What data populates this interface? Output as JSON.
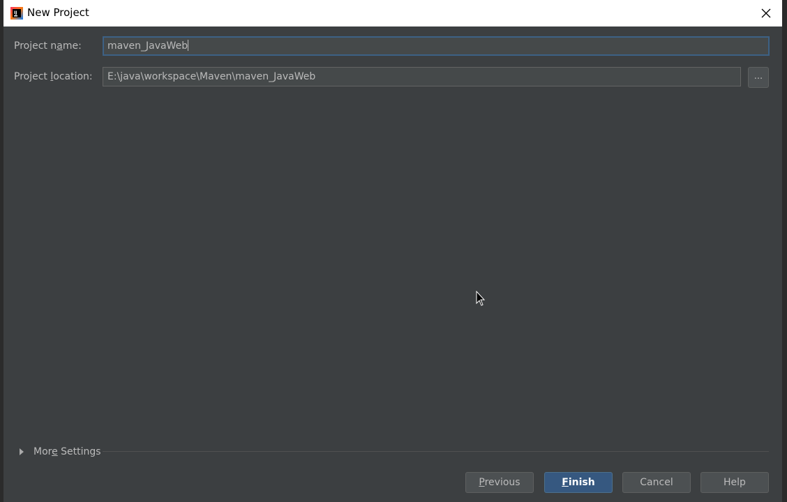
{
  "window": {
    "title": "New Project",
    "app_icon": "intellij-idea-icon",
    "close_icon": "close-icon"
  },
  "form": {
    "project_name": {
      "label_pre": "Project n",
      "label_mnemonic": "a",
      "label_post": "me:",
      "value": "maven_JavaWeb"
    },
    "project_location": {
      "label_pre": "Project ",
      "label_mnemonic": "l",
      "label_post": "ocation:",
      "value": "E:\\java\\workspace\\Maven\\maven_JavaWeb",
      "browse_label": "..."
    }
  },
  "more_settings": {
    "label_pre": "Mor",
    "label_mnemonic": "e",
    "label_post": " Settings",
    "expanded": false
  },
  "buttons": {
    "previous": {
      "mnemonic": "P",
      "rest": "revious"
    },
    "finish": {
      "mnemonic": "F",
      "rest": "inish"
    },
    "cancel": "Cancel",
    "help": "Help"
  },
  "colors": {
    "dialog_bg": "#3c3f41",
    "field_bg": "#45494a",
    "focus_border": "#3d6185",
    "primary_button": "#365880",
    "text": "#bbbbbb"
  }
}
